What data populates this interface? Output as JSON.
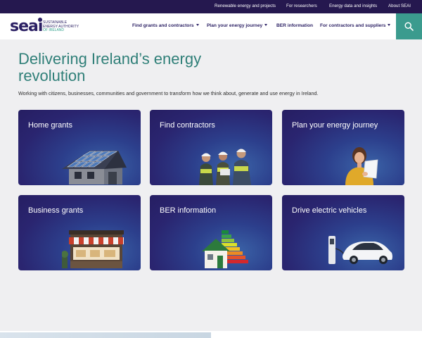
{
  "topbar": {
    "links": [
      "Renewable energy and projects",
      "For researchers",
      "Energy data and insights",
      "About SEAI"
    ]
  },
  "logo": {
    "word": "seai",
    "tagline": [
      "SUSTAINABLE",
      "ENERGY AUTHORITY",
      "OF IRELAND"
    ]
  },
  "nav": {
    "items": [
      "Find grants and contractors",
      "Plan your energy journey",
      "BER information",
      "For contractors and suppliers"
    ]
  },
  "hero": {
    "title": "Delivering Ireland’s energy revolution",
    "subtitle": "Working with citizens, businesses, communities and government to transform how we think about, generate and use energy in Ireland."
  },
  "cards": [
    {
      "title": "Home grants",
      "icon": "solar-house-icon"
    },
    {
      "title": "Find contractors",
      "icon": "contractors-icon"
    },
    {
      "title": "Plan your energy journey",
      "icon": "woman-tablet-icon"
    },
    {
      "title": "Business grants",
      "icon": "shopfront-icon"
    },
    {
      "title": "BER information",
      "icon": "energy-rating-house-icon"
    },
    {
      "title": "Drive electric vehicles",
      "icon": "ev-charging-icon"
    }
  ],
  "colors": {
    "topbar": "#25184f",
    "brand": "#2a1f63",
    "accent": "#3b9b8e",
    "heading": "#2f7f78",
    "card": "#2a2570"
  }
}
